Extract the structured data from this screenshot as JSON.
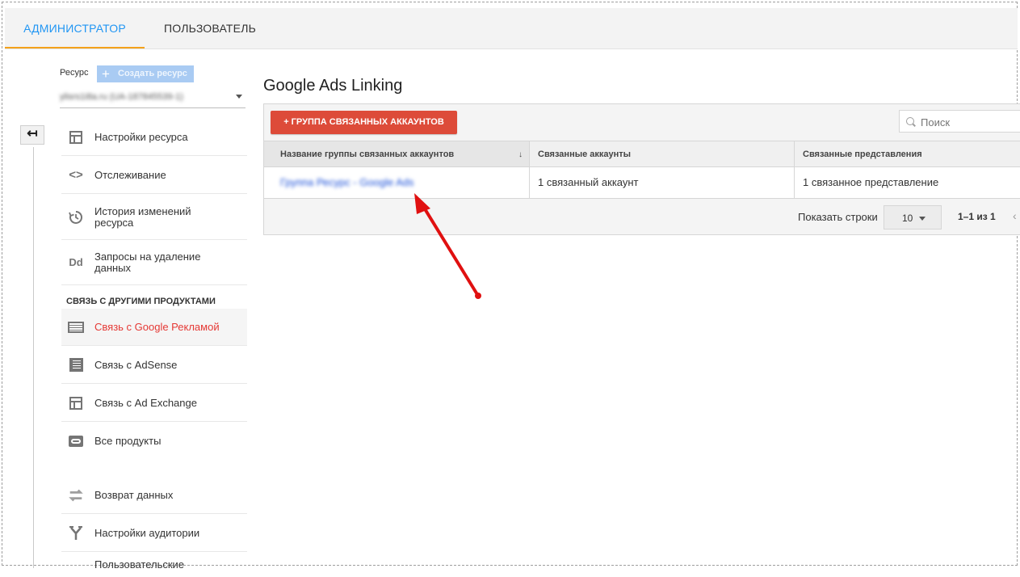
{
  "tabs": [
    {
      "label": "АДМИНИСТРАТОР",
      "active": true
    },
    {
      "label": "ПОЛЬЗОВАТЕЛЬ",
      "active": false
    }
  ],
  "sidebar": {
    "resource_label": "Ресурс",
    "create_button": "Создать ресурс",
    "resource_value": "ylisrs1i8a.ru (UA-187845539-1)",
    "collapse_glyph": "↤",
    "items": [
      {
        "label": "Настройки ресурса",
        "icon": "layout-icon"
      },
      {
        "label": "Отслеживание",
        "icon": "code-icon"
      },
      {
        "label": "История изменений ресурса",
        "icon": "history-icon"
      },
      {
        "label": "Запросы на удаление данных",
        "icon": "dd-icon"
      }
    ],
    "section_title": "СВЯЗЬ С ДРУГИМИ ПРОДУКТАМИ",
    "link_items": [
      {
        "label": "Связь с Google Рекламой",
        "icon": "ads-list-icon",
        "active": true
      },
      {
        "label": "Связь с AdSense",
        "icon": "adsense-icon"
      },
      {
        "label": "Связь с Ad Exchange",
        "icon": "layout-icon"
      },
      {
        "label": "Все продукты",
        "icon": "link-icon"
      }
    ],
    "other_items": [
      {
        "label": "Возврат данных",
        "icon": "swap-icon"
      },
      {
        "label": "Настройки аудитории",
        "icon": "fork-icon"
      },
      {
        "label": "Пользовательские",
        "icon": "custom-icon"
      }
    ]
  },
  "main": {
    "title": "Google Ads Linking",
    "add_button": "+ ГРУППА СВЯЗАННЫХ АККАУНТОВ",
    "search_placeholder": "Поиск",
    "columns": [
      "Название группы связанных аккаунтов",
      "Связанные аккаунты",
      "Связанные представления"
    ],
    "sort_glyph": "↓",
    "rows": [
      {
        "name": "Группа Ресурс - Google Ads",
        "accounts": "1 связанный аккаунт",
        "views": "1 связанное представление"
      }
    ],
    "pager": {
      "rows_label": "Показать строки",
      "rows_value": "10",
      "range": "1–1 из 1",
      "prev_glyph": "‹"
    }
  },
  "colors": {
    "accent": "#2196f3",
    "tab_underline": "#f4a21a",
    "add_button": "#dd4b39",
    "active_nav": "#e53935",
    "annotation_arrow": "#e01010"
  }
}
